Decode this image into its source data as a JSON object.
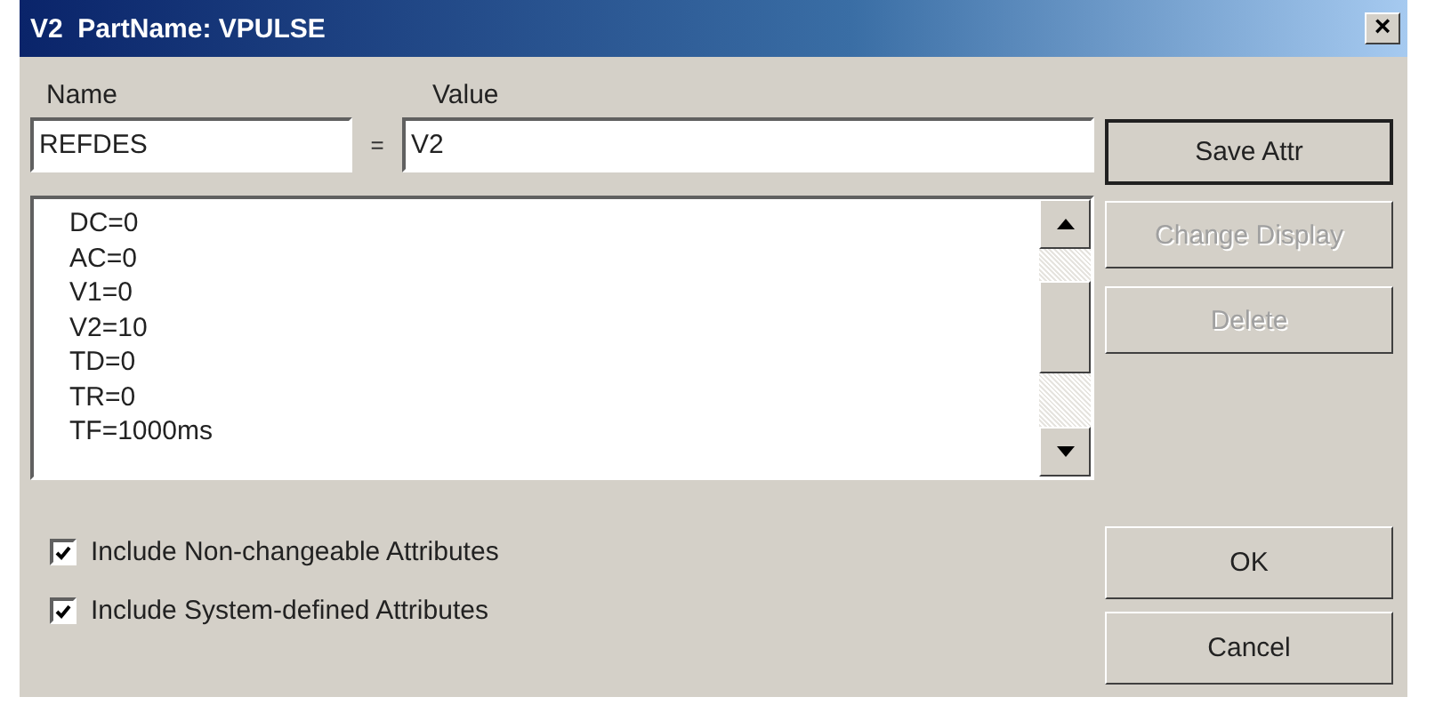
{
  "window": {
    "title": "V2  PartName: VPULSE",
    "close": "×"
  },
  "name_field": {
    "label": "Name",
    "value": "REFDES"
  },
  "equals": "=",
  "value_field": {
    "label": "Value",
    "value": "V2"
  },
  "attributes": [
    "DC=0",
    "AC=0",
    "V1=0",
    "V2=10",
    "TD=0",
    "TR=0",
    "TF=1000ms"
  ],
  "side_buttons": [
    {
      "label": "Save Attr",
      "disabled": false,
      "default": true
    },
    {
      "label": "Change Display",
      "disabled": true,
      "default": false
    },
    {
      "label": "Delete",
      "disabled": true,
      "default": false
    }
  ],
  "options": [
    {
      "label": "Include Non-changeable Attributes",
      "checked": true
    },
    {
      "label": "Include System-defined Attributes",
      "checked": true
    }
  ],
  "buttons": [
    "OK",
    "Cancel"
  ]
}
